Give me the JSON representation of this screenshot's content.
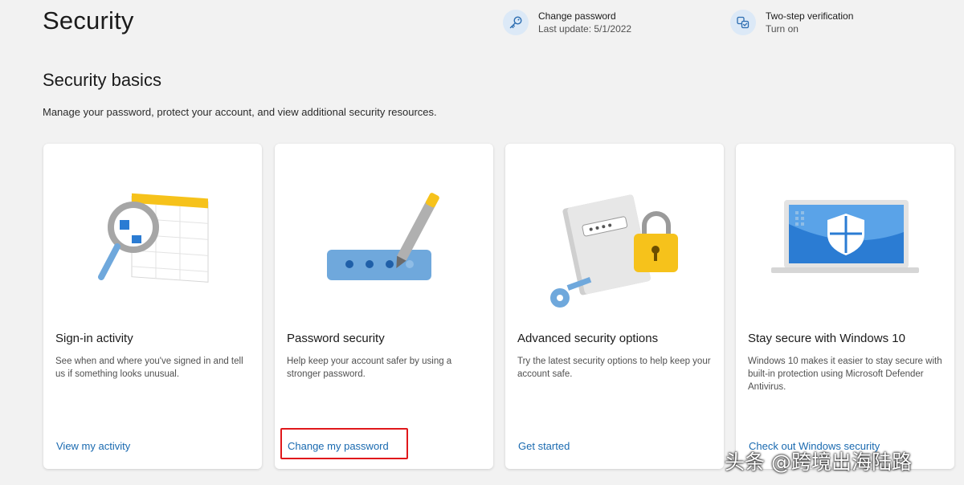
{
  "header": {
    "title": "Security",
    "quick_actions": [
      {
        "title": "Change password",
        "subtitle": "Last update: 5/1/2022",
        "icon": "key-icon"
      },
      {
        "title": "Two-step verification",
        "subtitle": "Turn on",
        "icon": "two-step-icon"
      }
    ]
  },
  "basics": {
    "title": "Security basics",
    "description": "Manage your password, protect your account, and view additional security resources."
  },
  "cards": [
    {
      "title": "Sign-in activity",
      "description": "See when and where you've signed in and tell us if something looks unusual.",
      "link": "View my activity",
      "icon": "magnifier-calendar-icon"
    },
    {
      "title": "Password security",
      "description": "Help keep your account safer by using a stronger password.",
      "link": "Change my password",
      "icon": "password-pen-icon"
    },
    {
      "title": "Advanced security options",
      "description": "Try the latest security options to help keep your account safe.",
      "link": "Get started",
      "icon": "notebook-lock-key-icon"
    },
    {
      "title": "Stay secure with Windows 10",
      "description": "Windows 10 makes it easier to stay secure with built-in protection using Microsoft Defender Antivirus.",
      "link": "Check out Windows security",
      "icon": "laptop-shield-icon"
    }
  ],
  "watermark": "头条 @跨境出海陆路",
  "colors": {
    "link": "#1a6ab0",
    "highlight": "#e0181b",
    "accent_blue": "#2b7cd3",
    "accent_yellow": "#f6c21b"
  }
}
